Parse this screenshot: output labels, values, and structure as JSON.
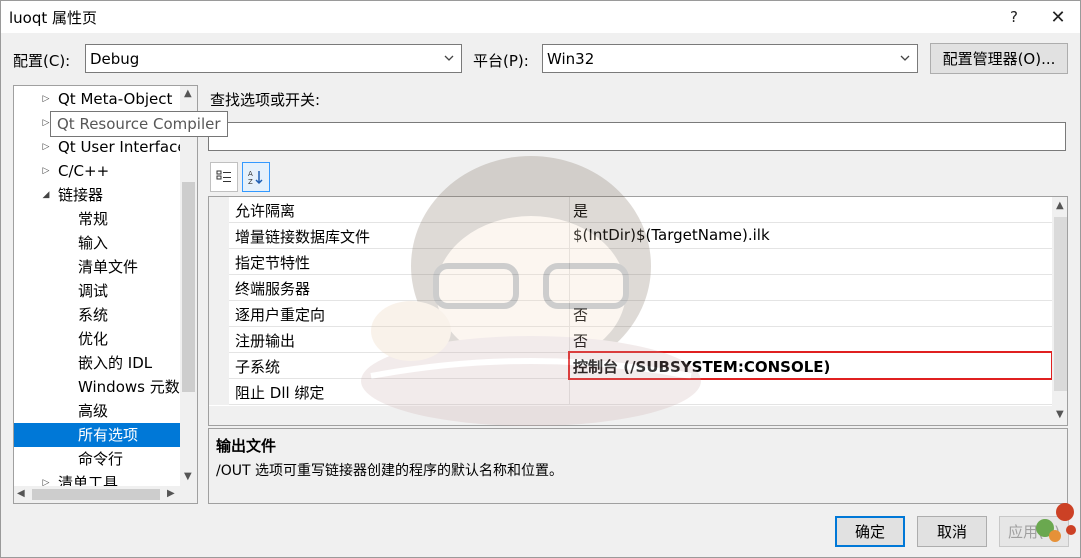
{
  "window": {
    "title": "luoqt 属性页",
    "help_glyph": "?",
    "close_glyph": "✕"
  },
  "config": {
    "config_label": "配置(C):",
    "config_value": "Debug",
    "platform_label": "平台(P):",
    "platform_value": "Win32",
    "manager_button": "配置管理器(O)..."
  },
  "tree": {
    "items": [
      {
        "label": "Qt Meta-Object",
        "expander": "▷",
        "indent": 0
      },
      {
        "label": "Qt Resource Compiler",
        "expander": "▷",
        "indent": 0
      },
      {
        "label": "Qt User Interface",
        "expander": "▷",
        "indent": 0
      },
      {
        "label": "C/C++",
        "expander": "▷",
        "indent": 0
      },
      {
        "label": "链接器",
        "expander": "◢",
        "indent": 0
      },
      {
        "label": "常规",
        "expander": "",
        "indent": 1
      },
      {
        "label": "输入",
        "expander": "",
        "indent": 1
      },
      {
        "label": "清单文件",
        "expander": "",
        "indent": 1
      },
      {
        "label": "调试",
        "expander": "",
        "indent": 1
      },
      {
        "label": "系统",
        "expander": "",
        "indent": 1
      },
      {
        "label": "优化",
        "expander": "",
        "indent": 1
      },
      {
        "label": "嵌入的 IDL",
        "expander": "",
        "indent": 1
      },
      {
        "label": "Windows 元数据",
        "expander": "",
        "indent": 1
      },
      {
        "label": "高级",
        "expander": "",
        "indent": 1
      },
      {
        "label": "所有选项",
        "expander": "",
        "indent": 1,
        "selected": true
      },
      {
        "label": "命令行",
        "expander": "",
        "indent": 1
      },
      {
        "label": "清单工具",
        "expander": "▷",
        "indent": 0
      }
    ],
    "tooltip": "Qt Resource Compiler"
  },
  "search": {
    "label": "查找选项或开关:",
    "value": ""
  },
  "grid": {
    "rows": [
      {
        "name": "允许隔离",
        "value": "是"
      },
      {
        "name": "增量链接数据库文件",
        "value": "$(IntDir)$(TargetName).ilk"
      },
      {
        "name": "指定节特性",
        "value": ""
      },
      {
        "name": "终端服务器",
        "value": ""
      },
      {
        "name": "逐用户重定向",
        "value": "否"
      },
      {
        "name": "注册输出",
        "value": "否"
      },
      {
        "name": "子系统",
        "value": "控制台 (/SUBSYSTEM:CONSOLE)",
        "bold": true
      },
      {
        "name": "阻止 Dll 绑定",
        "value": ""
      }
    ]
  },
  "description": {
    "title": "输出文件",
    "text": "/OUT 选项可重写链接器创建的程序的默认名称和位置。"
  },
  "buttons": {
    "ok": "确定",
    "cancel": "取消",
    "apply": "应用(A)"
  },
  "colors": {
    "selection": "#0078d7",
    "highlight_border": "#e02020"
  }
}
